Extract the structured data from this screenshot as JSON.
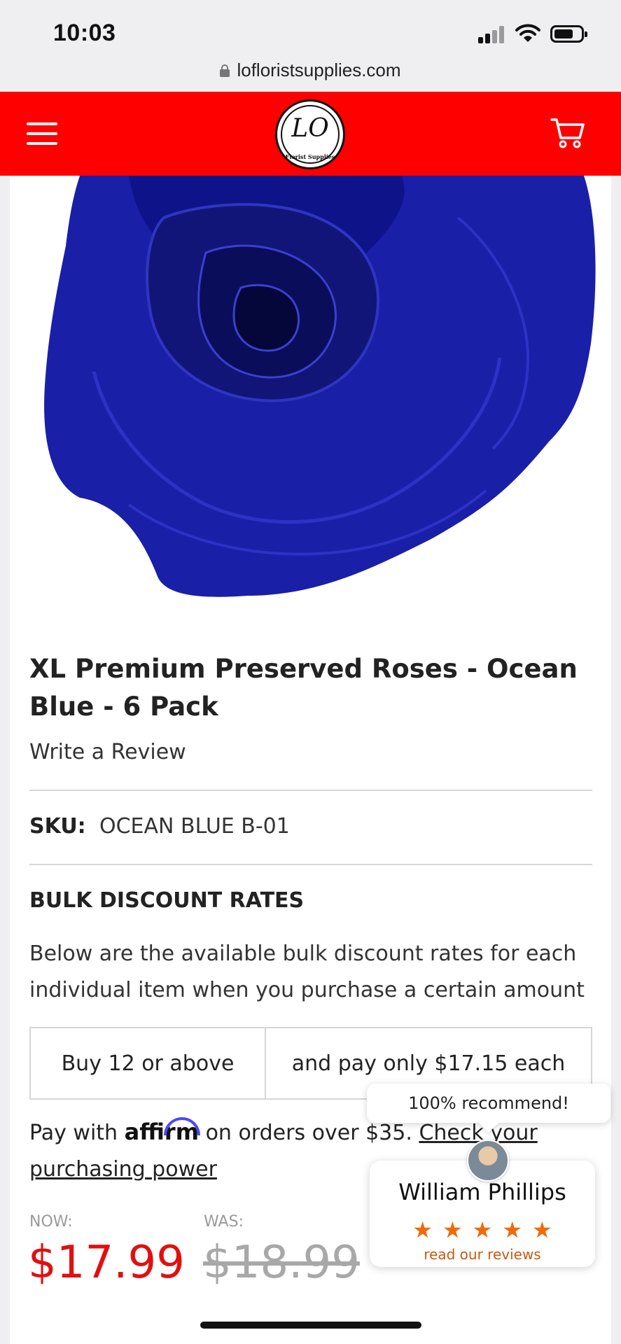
{
  "status_bar": {
    "time": "10:03"
  },
  "browser": {
    "url": "lofloristsupplies.com"
  },
  "header": {
    "logo_text": "LO",
    "logo_subtext": "Florist Supplies"
  },
  "product": {
    "title": "XL Premium Preserved Roses - Ocean Blue - 6 Pack",
    "write_review": "Write a Review",
    "sku_label": "SKU:",
    "sku_value": "OCEAN BLUE B-01",
    "bulk_heading": "BULK DISCOUNT RATES",
    "bulk_description": "Below are the available bulk discount rates for each individual item when you purchase a certain amount",
    "discount_rows": [
      {
        "quantity": "Buy 12 or above",
        "price": "and pay only $17.15 each"
      }
    ],
    "affirm": {
      "prefix": "Pay with",
      "logo": "affirm",
      "middle": "on orders over $35.",
      "link": "Check your purchasing power"
    },
    "now_label": "NOW:",
    "was_label": "WAS:",
    "price_now": "$17.99",
    "price_was": "$18.99"
  },
  "review_widget": {
    "recommend": "100% recommend!",
    "reviewer_name": "William Phillips",
    "rating": 5,
    "stars": "★★★★★",
    "reviews_link": "read our reviews"
  },
  "colors": {
    "brand_red": "#ff0000",
    "price_red": "#e01010",
    "star_orange": "#f06a0a",
    "rose_blue": "#1a1fa8"
  },
  "icons": [
    "lock-icon",
    "hamburger-icon",
    "cart-icon",
    "affirm-arc-icon"
  ]
}
